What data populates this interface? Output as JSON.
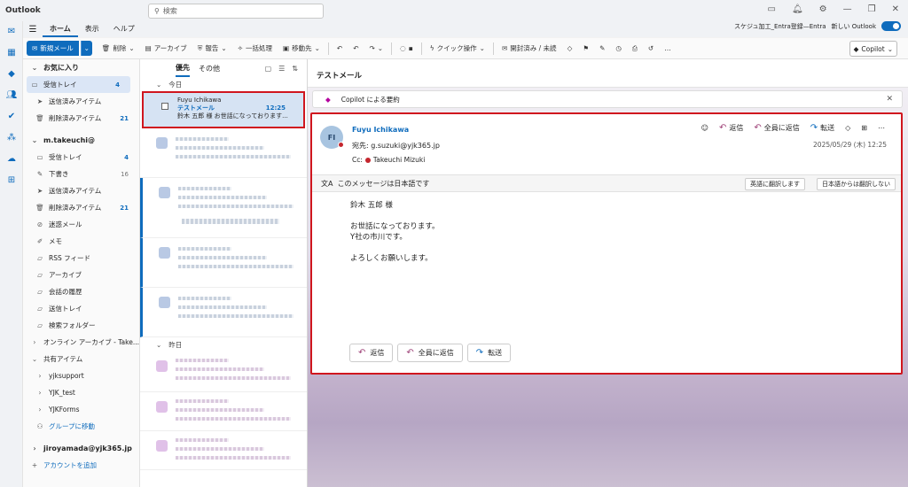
{
  "titlebar": {
    "app": "Outlook",
    "search_placeholder": "検索"
  },
  "ribbon": {
    "tabs": [
      "ホーム",
      "表示",
      "ヘルプ"
    ],
    "account": "スケジュ加工_Entra登録—Entra",
    "new_outlook": "新しい Outlook"
  },
  "toolbar": {
    "new_mail": "新規メール",
    "delete": "削除",
    "archive": "アーカイブ",
    "report": "報告",
    "sweep": "一括処理",
    "move": "移動先",
    "quick_steps": "クイック操作",
    "read_unread": "開封済み / 未読",
    "copilot": "Copilot"
  },
  "folders": {
    "favorites": "お気に入り",
    "fav_items": [
      {
        "label": "受信トレイ",
        "count": "4"
      },
      {
        "label": "送信済みアイテム",
        "count": ""
      },
      {
        "label": "削除済みアイテム",
        "count": "21"
      }
    ],
    "account": "m.takeuchi@",
    "items": [
      {
        "label": "受信トレイ",
        "count": "4"
      },
      {
        "label": "下書き",
        "count": "16"
      },
      {
        "label": "送信済みアイテム",
        "count": ""
      },
      {
        "label": "削除済みアイテム",
        "count": "21"
      },
      {
        "label": "迷惑メール",
        "count": ""
      },
      {
        "label": "メモ",
        "count": ""
      },
      {
        "label": "RSS フィード",
        "count": ""
      },
      {
        "label": "アーカイブ",
        "count": ""
      },
      {
        "label": "会話の履歴",
        "count": ""
      },
      {
        "label": "送信トレイ",
        "count": ""
      },
      {
        "label": "検索フォルダー",
        "count": ""
      },
      {
        "label": "オンライン アーカイブ - Take...",
        "count": ""
      }
    ],
    "shared": "共有アイテム",
    "shared_items": [
      "yjksupport",
      "YJK_test",
      "YJKForms"
    ],
    "go_group": "グループに移動",
    "account2": "jiroyamada@yjk365.jp",
    "add_account": "アカウントを追加"
  },
  "list": {
    "tab_focused": "優先",
    "tab_other": "その他",
    "today": "今日",
    "yesterday": "昨日",
    "selected": {
      "from": "Fuyu Ichikawa",
      "subject": "テストメール",
      "time": "12:25",
      "preview": "鈴木 五郎 様 お世話になっております..."
    }
  },
  "reading": {
    "title": "テストメール",
    "copilot_summary": "Copilot による要約",
    "avatar": "FI",
    "sender": "Fuyu Ichikawa",
    "to": "宛先: g.suzuki@yjk365.jp",
    "cc_label": "Cc:",
    "cc_name": "Takeuchi Mizuki",
    "reply": "返信",
    "reply_all": "全員に返信",
    "forward": "転送",
    "date": "2025/05/29 (木) 12:25",
    "translate_msg": "このメッセージは日本語です",
    "translate_en": "英語に翻訳します",
    "no_translate": "日本語からは翻訳しない",
    "body": [
      "鈴木 五郎 様",
      "お世話になっております。",
      "Y社の市川です。",
      "よろしくお願いします。"
    ]
  }
}
